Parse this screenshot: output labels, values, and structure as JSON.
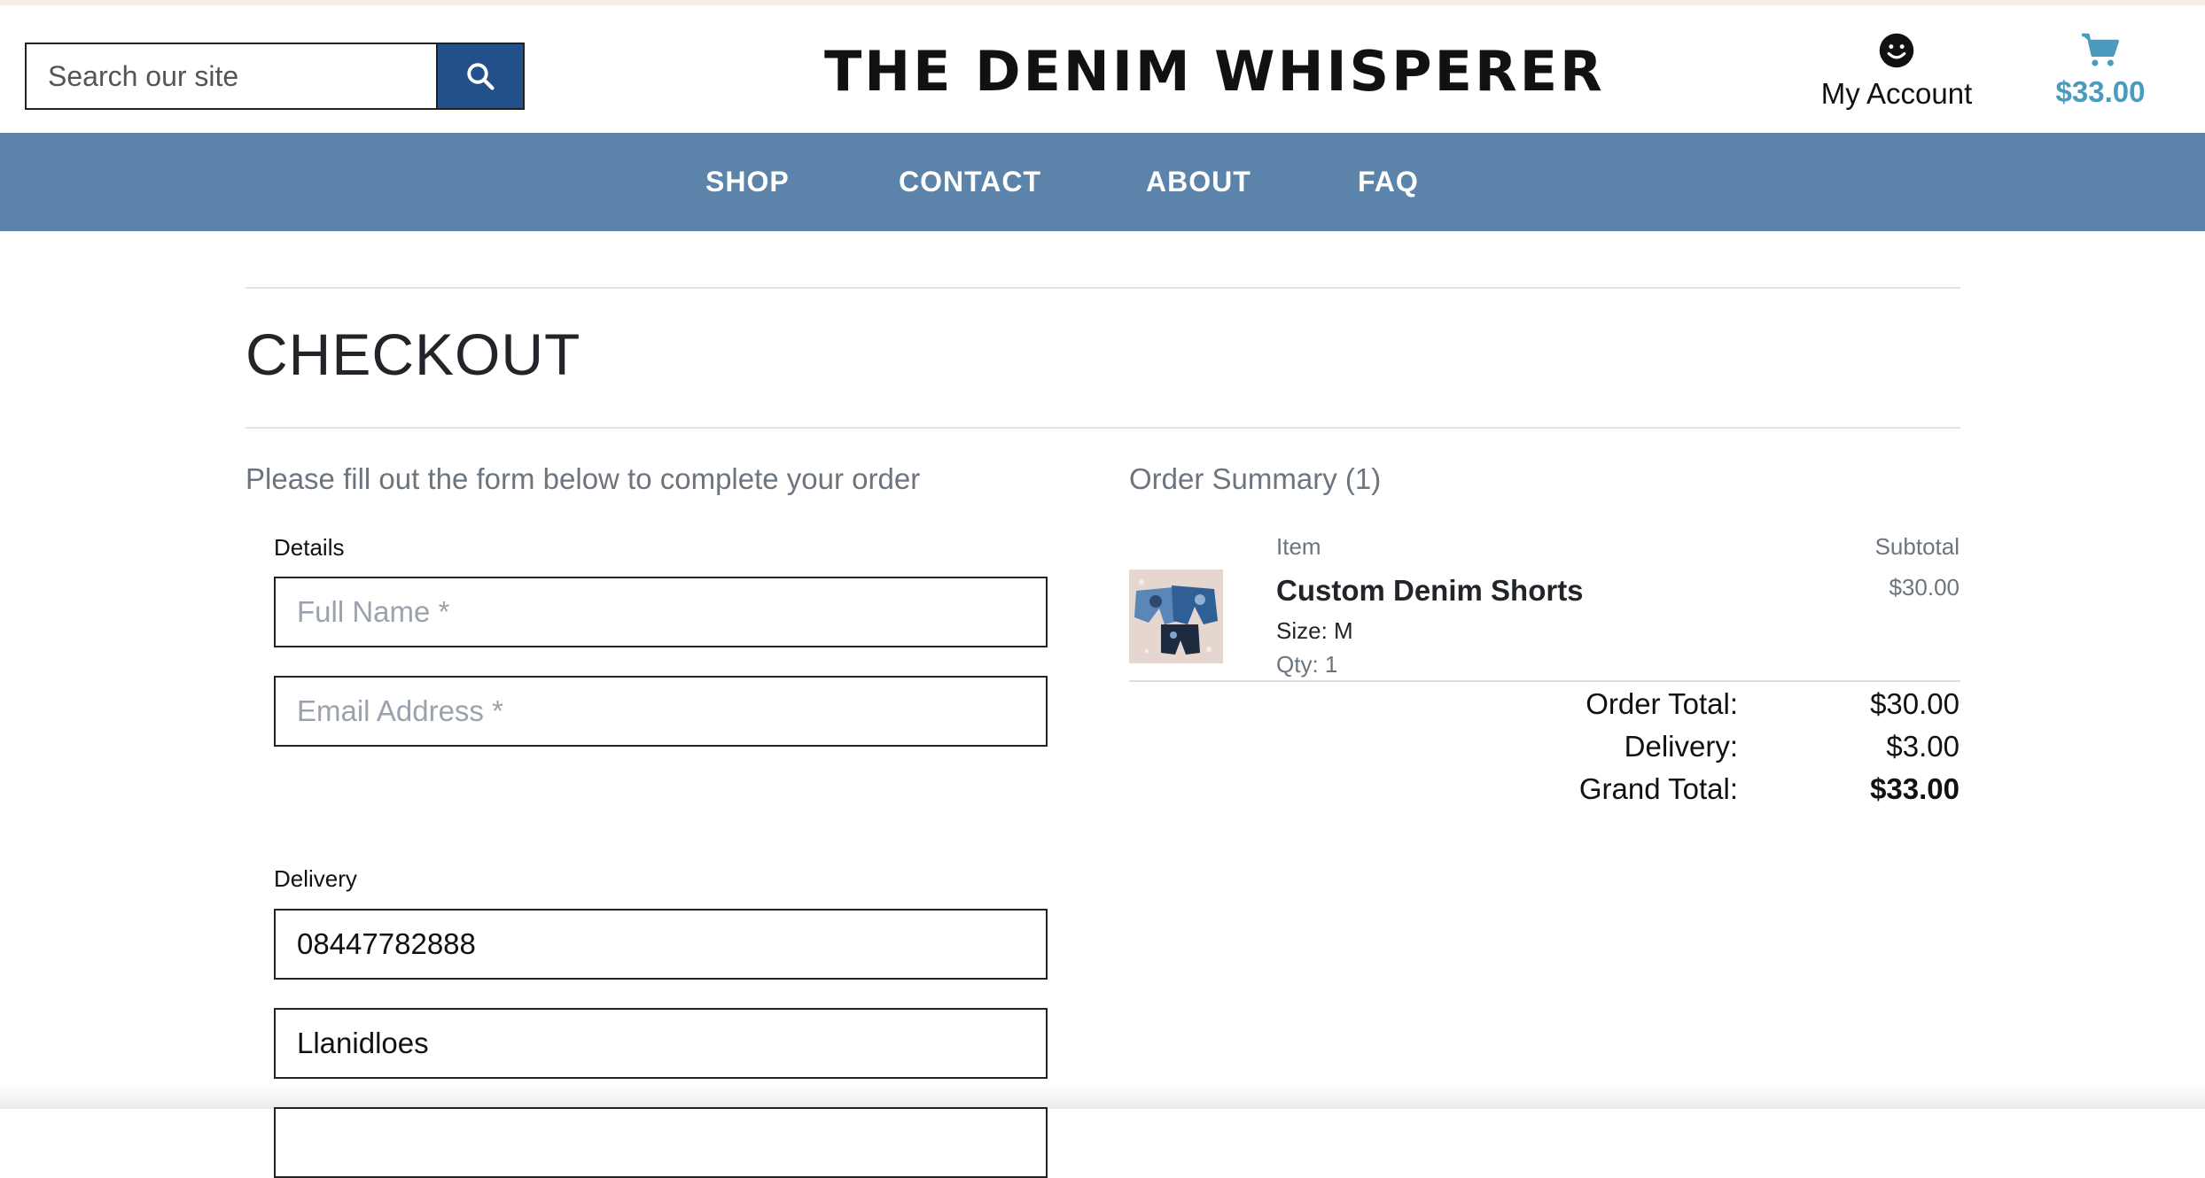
{
  "header": {
    "search_placeholder": "Search our site",
    "logo_text": "THE DENIM WHISPERER",
    "account_label": "My Account",
    "cart_total": "$33.00",
    "search_icon": "search-icon",
    "account_icon": "smiley-face-icon",
    "cart_icon": "shopping-cart-icon"
  },
  "nav": {
    "items": [
      "SHOP",
      "CONTACT",
      "ABOUT",
      "FAQ"
    ]
  },
  "checkout": {
    "title": "CHECKOUT",
    "intro": "Please fill out the form below to complete your order",
    "details_label": "Details",
    "full_name_placeholder": "Full Name *",
    "email_placeholder": "Email Address *",
    "delivery_label": "Delivery",
    "phone_value": "08447782888",
    "town_value": "Llanidloes"
  },
  "summary": {
    "title": "Order Summary (1)",
    "item_header": "Item",
    "subtotal_header": "Subtotal",
    "items": [
      {
        "name": "Custom Denim Shorts",
        "size": "Size: M",
        "qty": "Qty: 1",
        "subtotal": "$30.00"
      }
    ],
    "order_total_label": "Order Total:",
    "order_total_value": "$30.00",
    "delivery_label": "Delivery:",
    "delivery_value": "$3.00",
    "grand_total_label": "Grand Total:",
    "grand_total_value": "$33.00"
  },
  "colors": {
    "nav_bg": "#5c84aa",
    "search_button": "#21508a",
    "cart_accent": "#4a9bbe"
  }
}
